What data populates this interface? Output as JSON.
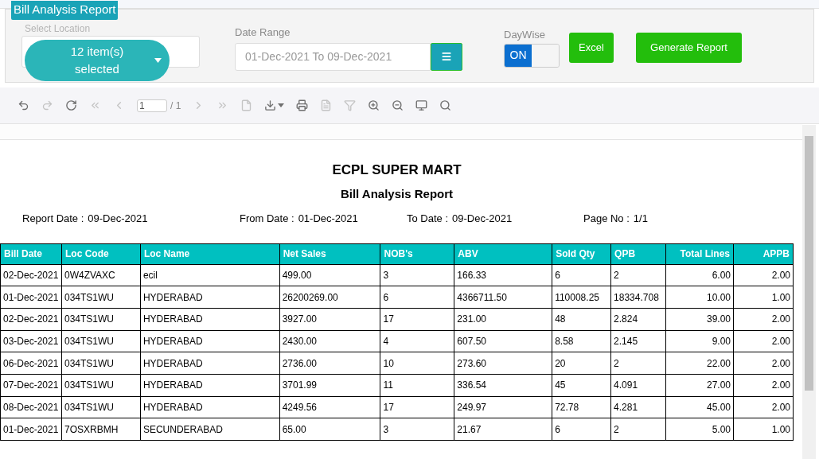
{
  "panel": {
    "title": "Bill Analysis Report",
    "location": {
      "label": "Select Location",
      "value": "12 item(s) selected"
    },
    "date_range": {
      "label": "Date Range",
      "value": "01-Dec-2021 To 09-Dec-2021"
    },
    "daywise": {
      "label": "DayWise",
      "on_text": "ON",
      "on": true
    },
    "buttons": [
      "Excel",
      "Generate Report"
    ]
  },
  "toolbar": {
    "items": [
      {
        "kind": "undo",
        "disabled": false
      },
      {
        "kind": "redo",
        "disabled": true
      },
      {
        "kind": "refresh",
        "disabled": false
      },
      {
        "kind": "first",
        "disabled": true
      },
      {
        "kind": "prev",
        "disabled": true
      },
      {
        "kind": "page"
      },
      {
        "kind": "next",
        "disabled": true
      },
      {
        "kind": "last",
        "disabled": true
      },
      {
        "kind": "export",
        "disabled": true
      },
      {
        "kind": "download",
        "disabled": false
      },
      {
        "kind": "print",
        "disabled": false
      },
      {
        "kind": "layout",
        "disabled": true
      },
      {
        "kind": "filter",
        "disabled": true
      },
      {
        "kind": "zoom_in",
        "disabled": false
      },
      {
        "kind": "zoom_out",
        "disabled": false
      },
      {
        "kind": "fullscreen",
        "disabled": false
      },
      {
        "kind": "search",
        "disabled": false
      }
    ],
    "page_value": "1",
    "page_total": "/ 1"
  },
  "report": {
    "company": "ECPL SUPER MART",
    "title": "Bill Analysis Report",
    "meta": [
      {
        "label": "Report Date :",
        "value": "09-Dec-2021"
      },
      {
        "label": "From Date :",
        "value": "01-Dec-2021"
      },
      {
        "label": "To Date :",
        "value": "09-Dec-2021"
      },
      {
        "label": "Page No :",
        "value": "1/1"
      }
    ],
    "table": {
      "columns": [
        "Bill Date",
        "Loc Code",
        "Loc Name",
        "Net Sales",
        "NOB's",
        "ABV",
        "Sold Qty",
        "QPB",
        "Total Lines",
        "APPB"
      ],
      "rows": [
        [
          "02-Dec-2021",
          "0W4ZVAXC",
          "ecil",
          "499.00",
          "3",
          "166.33",
          "6",
          "2",
          "6.00",
          "2.00"
        ],
        [
          "01-Dec-2021",
          "034TS1WU",
          "HYDERABAD",
          "26200269.00",
          "6",
          "4366711.50",
          "110008.25",
          "18334.708",
          "10.00",
          "1.00"
        ],
        [
          "02-Dec-2021",
          "034TS1WU",
          "HYDERABAD",
          "3927.00",
          "17",
          "231.00",
          "48",
          "2.824",
          "39.00",
          "2.00"
        ],
        [
          "03-Dec-2021",
          "034TS1WU",
          "HYDERABAD",
          "2430.00",
          "4",
          "607.50",
          "8.58",
          "2.145",
          "9.00",
          "2.00"
        ],
        [
          "06-Dec-2021",
          "034TS1WU",
          "HYDERABAD",
          "2736.00",
          "10",
          "273.60",
          "20",
          "2",
          "22.00",
          "2.00"
        ],
        [
          "07-Dec-2021",
          "034TS1WU",
          "HYDERABAD",
          "3701.99",
          "11",
          "336.54",
          "45",
          "4.091",
          "27.00",
          "2.00"
        ],
        [
          "08-Dec-2021",
          "034TS1WU",
          "HYDERABAD",
          "4249.56",
          "17",
          "249.97",
          "72.78",
          "4.281",
          "45.00",
          "2.00"
        ],
        [
          "01-Dec-2021",
          "7OSXRBMH",
          "SECUNDERABAD",
          "65.00",
          "3",
          "21.67",
          "6",
          "2",
          "5.00",
          "1.00"
        ]
      ]
    }
  }
}
